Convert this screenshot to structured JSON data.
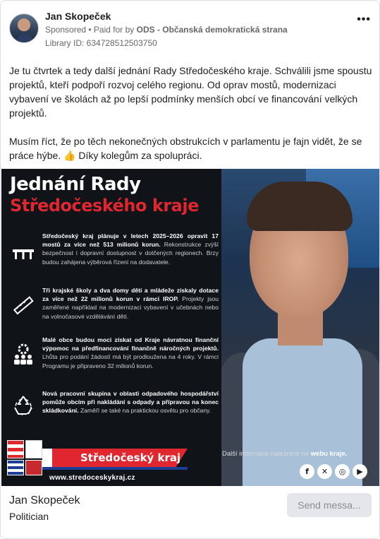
{
  "post": {
    "author": "Jan Skopeček",
    "sponsored": "Sponsored",
    "paid_for_prefix": " • Paid for by ",
    "paid_for_org": "ODS - Občanská demokratická strana",
    "library_id": "Library ID: 634728512503750",
    "more_icon": "more-options-icon",
    "paragraph1": "Je tu čtvrtek a tedy další jednání Rady Středočeského kraje. Schválili jsme spoustu projektů, kteří podpoří rozvoj celého regionu. Od oprav mostů, modernizaci vybavení ve školách až po lepší podmínky menších obcí ve financování velkých projektů.",
    "paragraph2": "Musím říct, že po těch nekonečných obstrukcích v parlamentu je fajn vidět, že se práce hýbe.",
    "paragraph2_tail": " Díky kolegům za spolupráci.",
    "thumb_emoji": "👍"
  },
  "creative": {
    "title_line1": "Jednání Rady",
    "title_line2": "Středočeského kraje",
    "items": [
      {
        "icon": "bridge-icon",
        "highlight": "Středočeský kraj plánuje v letech 2025–2026 opravit 17 mostů za více než 513 milionů korun.",
        "text": " Rekonstrukce zvýší bezpečnost i dopravní dostupnost v dotčených regionech. Brzy budou zahájena výběrová řízení na dodavatele."
      },
      {
        "icon": "ruler-pencil-icon",
        "highlight": "Tři krajské školy a dva domy dětí a mládeže získaly dotace za více než 22 milionů korun v rámci IROP.",
        "text": " Projekty jsou zaměřené například na modernizaci vybavení v učebnách nebo na volnočasové vzdělávání dětí."
      },
      {
        "icon": "people-gear-icon",
        "highlight": "Malé obce budou moci získat od Kraje návratnou finanční výpomoc na předfinancování finančně náročných projektů.",
        "text": " Lhůta pro podání žádostí má být prodloužena na 4 roky. V rámci Programu je připraveno 32 milionů korun."
      },
      {
        "icon": "recycle-icon",
        "highlight": "Nová pracovní skupina v oblasti odpadového hospodářství pomůže obcím při nakládání s odpady a přípravou na konec skládkování.",
        "text": " Zaměří se také na praktickou osvětu pro občany."
      }
    ],
    "region_label": "Středočeský kraj",
    "url": "www.stredoceskykraj.cz",
    "info_prefix": "Další informace naleznete na ",
    "info_highlight": "webu kraje.",
    "socials": [
      {
        "icon": "facebook-icon",
        "glyph": "f"
      },
      {
        "icon": "x-icon",
        "glyph": "✕"
      },
      {
        "icon": "instagram-icon",
        "glyph": "◎"
      },
      {
        "icon": "youtube-icon",
        "glyph": "▶"
      }
    ]
  },
  "footer": {
    "page_name": "Jan Skopeček",
    "category": "Politician",
    "send_button": "Send messa..."
  },
  "colors": {
    "accent_red": "#e0262f",
    "region_blue": "#1c3f95",
    "meta_gray": "#65676b",
    "button_bg": "#e4e6eb"
  }
}
